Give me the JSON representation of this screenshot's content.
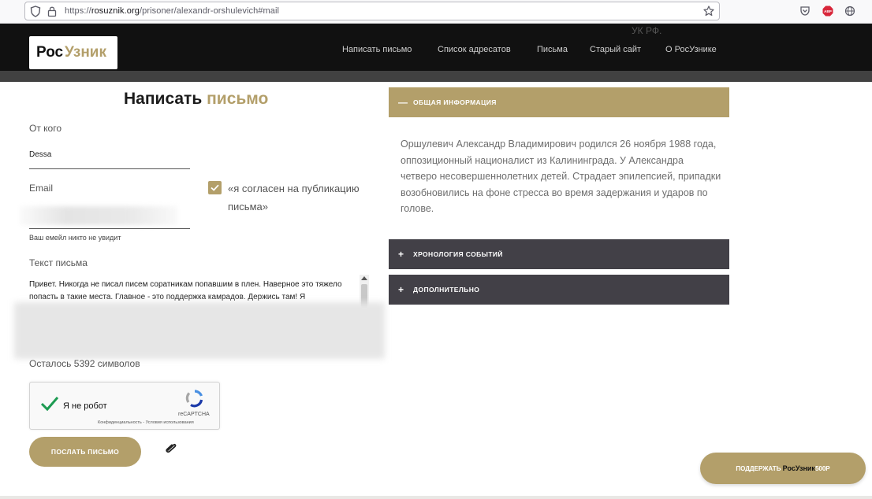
{
  "browser": {
    "url_prefix": "https://",
    "url_domain": "rosuznik.org",
    "url_path": "/prisoner/alexandr-orshulevich#mail",
    "icons": [
      "shield-icon",
      "lock-icon",
      "bookmark-star-icon",
      "pocket-icon",
      "adblock-icon",
      "globe-icon"
    ],
    "adblock_label": "ABP"
  },
  "header": {
    "logo_part1": "Рос",
    "logo_part2": "Узник",
    "ghost_text": "УК РФ.",
    "nav": [
      "Написать письмо",
      "Список адресатов",
      "Письма",
      "Старый сайт",
      "О РосУзнике"
    ]
  },
  "form": {
    "title_part1": "Написать",
    "title_part2": "письмо",
    "from_label": "От кого",
    "from_value": "Dessa",
    "email_label": "Email",
    "email_note": "Ваш емейл никто не увидит",
    "consent_text": "«я согласен на публикацию письма»",
    "consent_checked": true,
    "message_label": "Текст письма",
    "message_text": "Привет. Никогда не писал писем соратникам попавшим в плен. Наверное это тяжело попасть в такие места. Главное - это поддержка камрадов. Держись там! Я",
    "remaining": "Осталось 5392 символов",
    "captcha_label": "Я не робот",
    "captcha_brand": "reCAPTCHA",
    "captcha_terms": "Конфиденциальность - Условия использования",
    "send_button": "ПОСЛАТЬ ПИСЬМО",
    "attach_icon": "paperclip-icon"
  },
  "accordion": {
    "items": [
      {
        "sign": "—",
        "title": "ОБЩАЯ ИНФОРМАЦИЯ",
        "expanded": true
      },
      {
        "sign": "+",
        "title": "ХРОНОЛОГИЯ СОБЫТИЙ",
        "expanded": false
      },
      {
        "sign": "+",
        "title": "ДОПОЛНИТЕЛЬНО",
        "expanded": false
      }
    ],
    "body": "Оршулевич Александр Владимирович родился 26 ноября 1988 года, оппозиционный националист из Калининграда. У Александра четверо несовершеннолетних детей. Страдает эпилепсией, припадки возобновились на фоне стресса во время задержания и ударов по голове."
  },
  "support": {
    "prefix": "ПОДДЕРЖАТЬ",
    "brand": "РосУзник",
    "amount": "500Р"
  },
  "colors": {
    "accent": "#b39f6a",
    "header_bg": "#111111",
    "accordion_dark": "#424047"
  }
}
